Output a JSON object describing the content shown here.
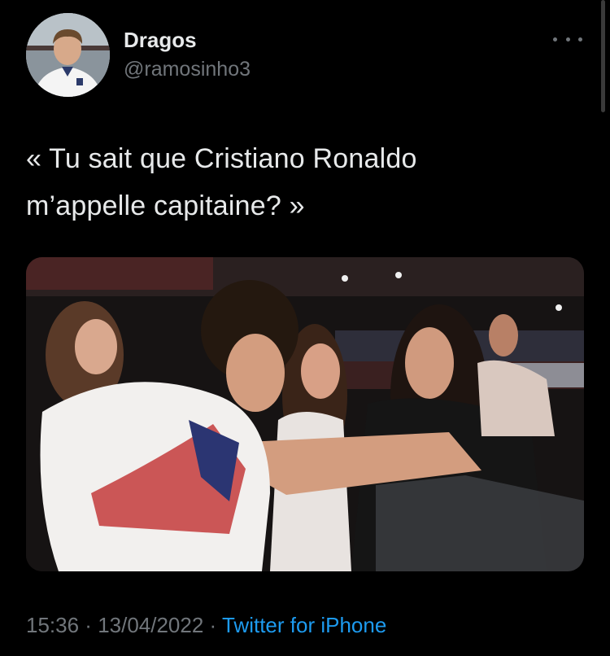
{
  "user": {
    "display_name": "Dragos",
    "handle": "@ramosinho3",
    "avatar_icon": "profile-photo"
  },
  "tweet": {
    "text": "« Tu sait que Cristiano Ronaldo\nm’appelle capitaine? »",
    "time": "15:36",
    "separator": " · ",
    "date": "13/04/2022",
    "source": "Twitter for iPhone"
  },
  "icons": {
    "more": "more-horizontal-icon"
  },
  "colors": {
    "background": "#000000",
    "text_primary": "#e7e9ea",
    "text_secondary": "#71767b",
    "link": "#1d9bf0"
  }
}
